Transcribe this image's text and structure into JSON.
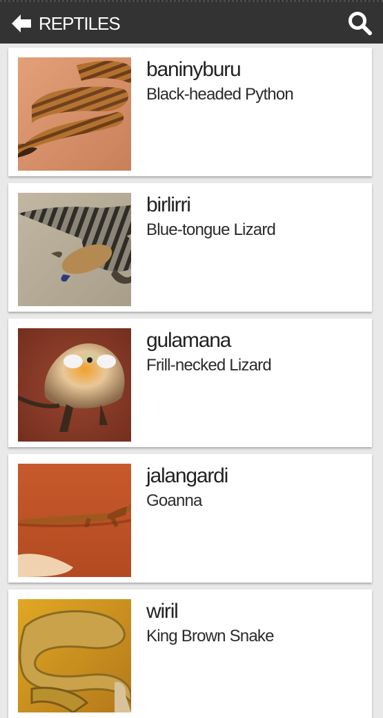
{
  "header": {
    "title": "REPTILES",
    "back_icon": "arrow-left-icon",
    "search_icon": "search-icon"
  },
  "items": [
    {
      "name": "baninyburu",
      "common": "Black-headed Python",
      "image": "python-photo"
    },
    {
      "name": "birlirri",
      "common": "Blue-tongue Lizard",
      "image": "blue-tongue-photo"
    },
    {
      "name": "gulamana",
      "common": "Frill-necked Lizard",
      "image": "frill-neck-photo"
    },
    {
      "name": "jalangardi",
      "common": "Goanna",
      "image": "goanna-photo"
    },
    {
      "name": "wiril",
      "common": "King Brown Snake",
      "image": "king-brown-photo"
    }
  ]
}
